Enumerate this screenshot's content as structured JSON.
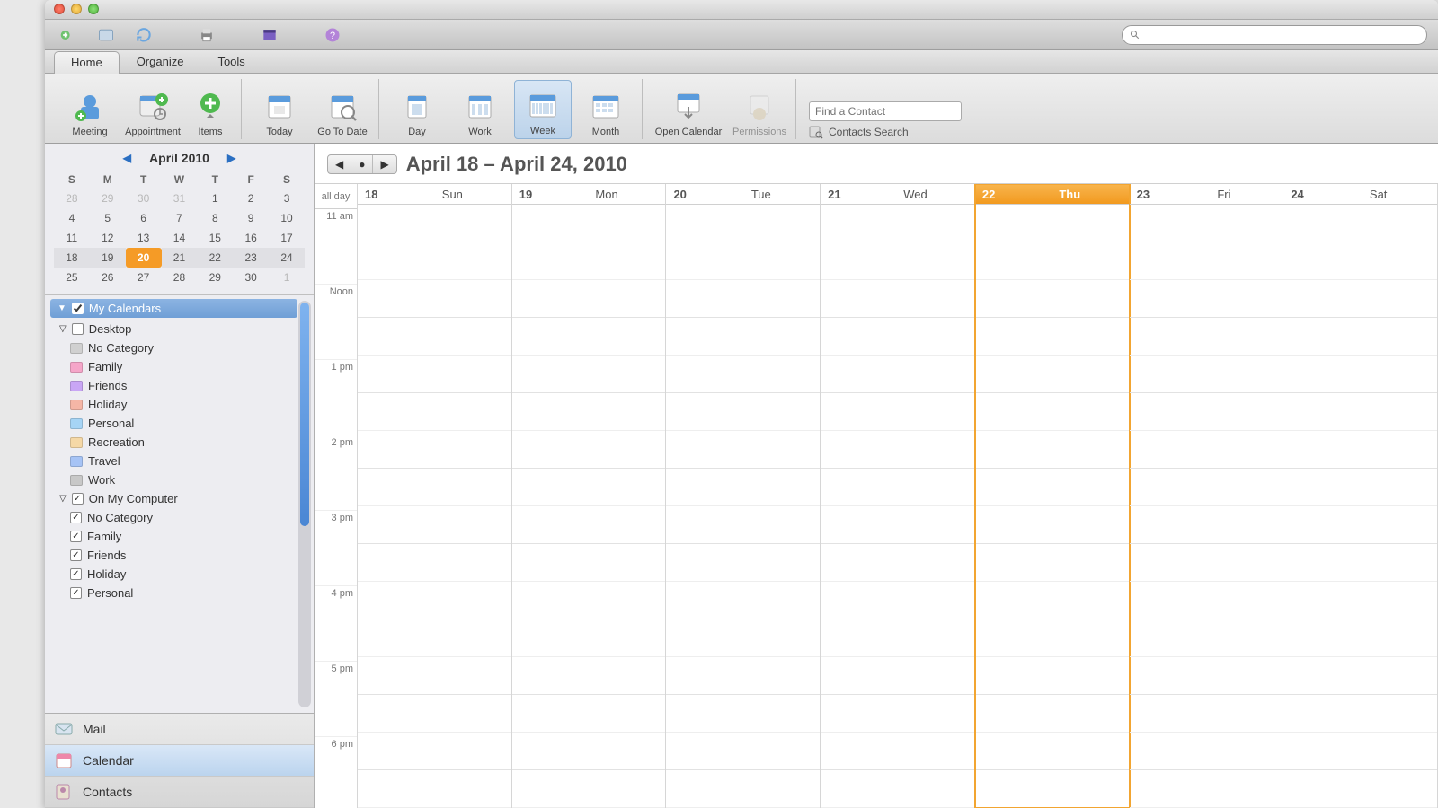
{
  "tabs": {
    "home": "Home",
    "organize": "Organize",
    "tools": "Tools",
    "active": "home"
  },
  "ribbon": {
    "meeting": "Meeting",
    "appointment": "Appointment",
    "items": "Items",
    "today": "Today",
    "gotodate": "Go To Date",
    "day": "Day",
    "work": "Work",
    "week": "Week",
    "month": "Month",
    "opencal": "Open Calendar",
    "permissions": "Permissions",
    "find_contact_placeholder": "Find a Contact",
    "contacts_search": "Contacts Search"
  },
  "minical": {
    "title": "April 2010",
    "dow": [
      "S",
      "M",
      "T",
      "W",
      "T",
      "F",
      "S"
    ],
    "rows": [
      [
        {
          "d": "28",
          "o": 1
        },
        {
          "d": "29",
          "o": 1
        },
        {
          "d": "30",
          "o": 1
        },
        {
          "d": "31",
          "o": 1
        },
        {
          "d": "1"
        },
        {
          "d": "2"
        },
        {
          "d": "3"
        }
      ],
      [
        {
          "d": "4"
        },
        {
          "d": "5"
        },
        {
          "d": "6"
        },
        {
          "d": "7"
        },
        {
          "d": "8"
        },
        {
          "d": "9"
        },
        {
          "d": "10"
        }
      ],
      [
        {
          "d": "11"
        },
        {
          "d": "12"
        },
        {
          "d": "13"
        },
        {
          "d": "14"
        },
        {
          "d": "15"
        },
        {
          "d": "16"
        },
        {
          "d": "17"
        }
      ],
      [
        {
          "d": "18",
          "w": 1
        },
        {
          "d": "19",
          "w": 1
        },
        {
          "d": "20",
          "w": 1,
          "sel": 1
        },
        {
          "d": "21",
          "w": 1
        },
        {
          "d": "22",
          "w": 1
        },
        {
          "d": "23",
          "w": 1
        },
        {
          "d": "24",
          "w": 1
        }
      ],
      [
        {
          "d": "25"
        },
        {
          "d": "26"
        },
        {
          "d": "27"
        },
        {
          "d": "28"
        },
        {
          "d": "29"
        },
        {
          "d": "30"
        },
        {
          "d": "1",
          "o": 1
        }
      ]
    ]
  },
  "tree": {
    "header": "My Calendars",
    "desktop": {
      "label": "Desktop",
      "items": [
        {
          "label": "No Category",
          "color": "#d0d0d0"
        },
        {
          "label": "Family",
          "color": "#f5a6c9"
        },
        {
          "label": "Friends",
          "color": "#c9a6f5"
        },
        {
          "label": "Holiday",
          "color": "#f5b6a6"
        },
        {
          "label": "Personal",
          "color": "#a6d4f5"
        },
        {
          "label": "Recreation",
          "color": "#f5d8a6"
        },
        {
          "label": "Travel",
          "color": "#a6c3f5"
        },
        {
          "label": "Work",
          "color": "#c8c8c8"
        }
      ]
    },
    "computer": {
      "label": "On My Computer",
      "items": [
        {
          "label": "No Category",
          "checked": true
        },
        {
          "label": "Family",
          "checked": true
        },
        {
          "label": "Friends",
          "checked": true
        },
        {
          "label": "Holiday",
          "checked": true
        },
        {
          "label": "Personal",
          "checked": true
        }
      ]
    }
  },
  "nav": {
    "mail": "Mail",
    "calendar": "Calendar",
    "contacts": "Contacts"
  },
  "range": {
    "title": "April 18 – April 24, 2010"
  },
  "days": [
    {
      "num": "18",
      "name": "Sun"
    },
    {
      "num": "19",
      "name": "Mon"
    },
    {
      "num": "20",
      "name": "Tue"
    },
    {
      "num": "21",
      "name": "Wed"
    },
    {
      "num": "22",
      "name": "Thu",
      "today": true
    },
    {
      "num": "23",
      "name": "Fri"
    },
    {
      "num": "24",
      "name": "Sat"
    }
  ],
  "times": {
    "allday": "all day",
    "hours": [
      "11 am",
      "Noon",
      "1 pm",
      "2 pm",
      "3 pm",
      "4 pm",
      "5 pm",
      "6 pm"
    ]
  }
}
